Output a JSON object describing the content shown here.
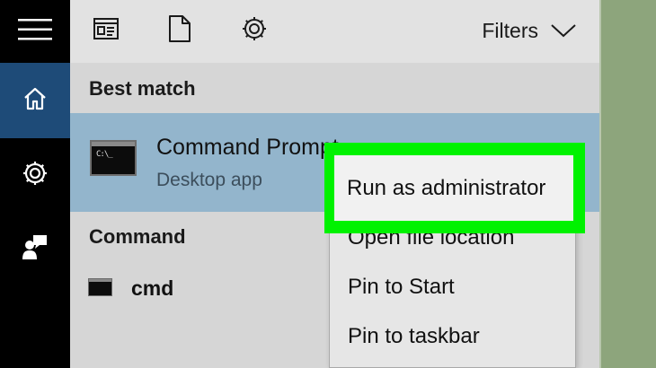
{
  "rail": {
    "menu_icon": "hamburger-icon",
    "home_icon": "home-icon",
    "settings_icon": "gear-icon",
    "feedback_icon": "feedback-icon"
  },
  "toolbar": {
    "apps_icon": "apps-filter-icon",
    "documents_icon": "document-icon",
    "settings_icon": "gear-icon",
    "filters_label": "Filters",
    "filters_icon": "chevron-down-icon"
  },
  "best_match": {
    "heading": "Best match",
    "app_name": "Command Prompt",
    "app_type": "Desktop app",
    "icon_text": "C:\\_"
  },
  "command_section": {
    "heading": "Command",
    "item_label": "cmd"
  },
  "context_menu": {
    "items": [
      "Run as administrator",
      "Open file location",
      "Pin to Start",
      "Pin to taskbar"
    ]
  },
  "colors": {
    "highlight": "#00f200",
    "selected_row": "#93b5cc",
    "rail": "#000000",
    "rail_active": "#1e4b78"
  }
}
